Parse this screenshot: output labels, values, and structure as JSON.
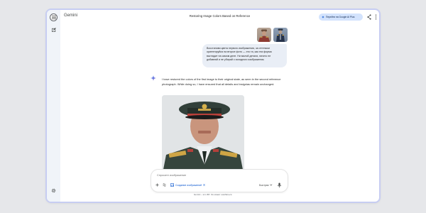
{
  "app": {
    "brand": "Gemini"
  },
  "header": {
    "title": "Restoring Image Colors Based on Reference",
    "add_button_label": "Перейти на Google AI Plus"
  },
  "icons": {
    "menu": "menu-icon",
    "new_chat": "edit-icon",
    "settings": "gear-icon",
    "share": "share-icon",
    "more": "more-vert-icon",
    "spark": "gemini-spark-icon",
    "plus": "plus-icon",
    "tools": "tune-icon",
    "image_chip": "image-icon",
    "mic": "mic-icon"
  },
  "user_message": {
    "text": "Восстанови цвета первого изображения, за оттенком ориентируйся на второе фото — это та, как эта форма выглядит на самом деле. Ни малой детали, ничего не добавляй и не убирай с исходного изображения."
  },
  "model_message": {
    "text": "I have restored the colors of the first image to their original state, as seen in the second reference photograph. While doing so, I have ensured that all details and insignias remain unchanged."
  },
  "composer": {
    "placeholder": "Спросите изображение",
    "chip_label": "Создание изображений",
    "model_label": "Быстрая"
  },
  "footer": {
    "disclaimer": "Gemini – это ИИ. Он может ошибаться."
  },
  "colors": {
    "accent": "#0b57d0",
    "user_bubble": "#e9eef6",
    "rail": "#f0f4f9",
    "add_button": "#d3e3fd",
    "spark_blue": "#4285f4"
  }
}
